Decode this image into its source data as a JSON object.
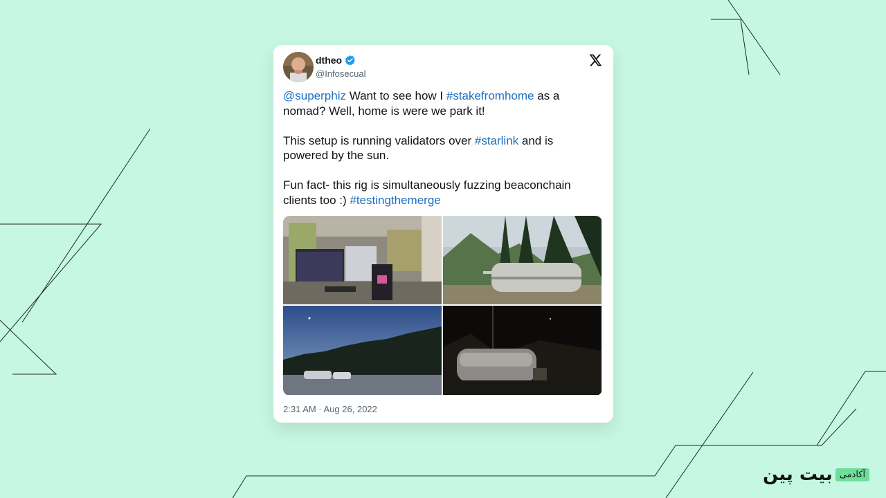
{
  "tweet": {
    "author_name": "dtheo",
    "author_handle": "@Infosecual",
    "verified": true,
    "paragraphs": [
      [
        {
          "text": "@superphiz",
          "link": true
        },
        {
          "text": " Want to see how I ",
          "link": false
        },
        {
          "text": "#stakefromhome",
          "link": true
        },
        {
          "text": " as a nomad? Well, home is were we park it!",
          "link": false
        }
      ],
      [
        {
          "text": "This setup is running validators over ",
          "link": false
        },
        {
          "text": "#starlink",
          "link": true
        },
        {
          "text": " and is powered by the sun.",
          "link": false
        }
      ],
      [
        {
          "text": "Fun fact- this rig is simultaneously fuzzing beaconchain clients too :) ",
          "link": false
        },
        {
          "text": "#testingthemerge",
          "link": true
        }
      ]
    ],
    "timestamp": "2:31 AM · Aug 26, 2022"
  },
  "brand": {
    "name": "بیت پین",
    "tag": "آکادمی"
  },
  "colors": {
    "background": "#c6f7e2",
    "link": "#1d6fc2",
    "verified": "#1d9bf0",
    "brand_tag": "#6fde99"
  },
  "icons": [
    "verified-badge-icon",
    "x-logo-icon"
  ]
}
